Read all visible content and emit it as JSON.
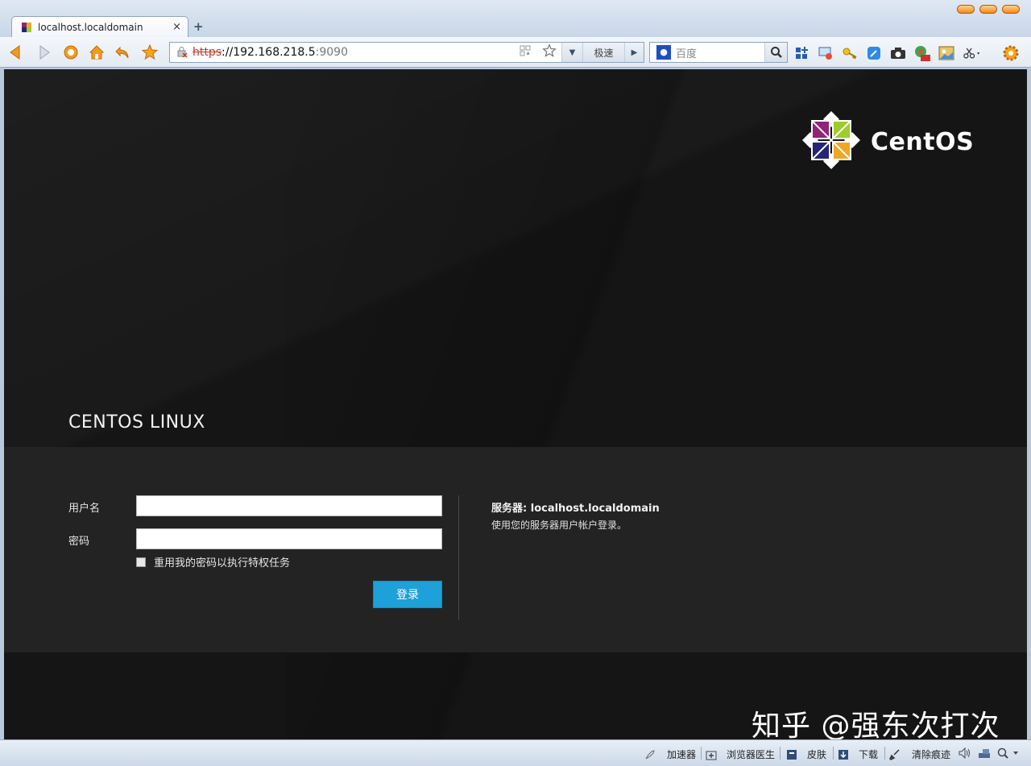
{
  "browser": {
    "tab": {
      "title": "localhost.localdomain",
      "close": "×"
    },
    "new_tab": "+",
    "address": {
      "scheme": "https",
      "separator": "://",
      "host": "192.168.218.5",
      "port": ":9090"
    },
    "speed_label": "极速",
    "search": {
      "placeholder": "百度"
    }
  },
  "page": {
    "brand": "CentOS",
    "os_title": "CENTOS LINUX",
    "form": {
      "username_label": "用户名",
      "password_label": "密码",
      "reuse_password_label": "重用我的密码以执行特权任务",
      "login_button": "登录"
    },
    "server": {
      "label": "服务器:",
      "name": "localhost.localdomain",
      "hint": "使用您的服务器用户帐户登录。"
    },
    "watermark": "知乎 @强东次打次"
  },
  "statusbar": {
    "accelerator": "加速器",
    "doctor": "浏览器医生",
    "skin": "皮肤",
    "download": "下载",
    "clear": "清除痕迹"
  },
  "colors": {
    "accent": "#1ea0d8",
    "page_bg": "#151515",
    "band_bg": "#232323"
  }
}
